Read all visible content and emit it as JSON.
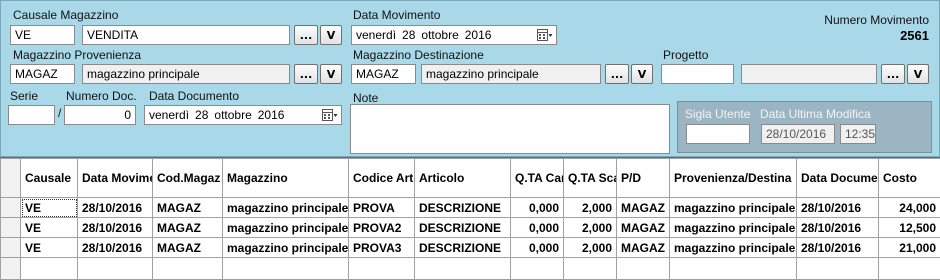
{
  "header": {
    "causale_label": "Causale Magazzino",
    "causale_code": "VE",
    "causale_desc": "VENDITA",
    "data_movimento_label": "Data Movimento",
    "data_movimento": {
      "weekday": "venerdì",
      "day": "28",
      "month": "ottobre",
      "year": "2016"
    },
    "numero_movimento_label": "Numero Movimento",
    "numero_movimento": "2561",
    "mag_prov_label": "Magazzino Provenienza",
    "mag_prov_code": "MAGAZ",
    "mag_prov_desc": "magazzino principale",
    "mag_dest_label": "Magazzino Destinazione",
    "mag_dest_code": "MAGAZ",
    "mag_dest_desc": "magazzino principale",
    "progetto_label": "Progetto",
    "progetto_code": "",
    "progetto_desc": "",
    "serie_label": "Serie",
    "serie_value": "",
    "num_doc_label": "Numero Doc.",
    "num_doc_sep": "/",
    "num_doc_value": "0",
    "data_doc_label": "Data Documento",
    "data_documento": {
      "weekday": "venerdì",
      "day": "28",
      "month": "ottobre",
      "year": "2016"
    },
    "note_label": "Note",
    "note_value": "",
    "sigla_label": "Sigla Utente",
    "sigla_value": "",
    "ultima_mod_label": "Data Ultima Modifica",
    "ultima_mod_date": "28/10/2016",
    "ultima_mod_time": "12:35",
    "dots_button": "...",
    "v_button": "V"
  },
  "grid": {
    "columns": [
      "Causale",
      "Data Movimento",
      "Cod.Magaz",
      "Magazzino",
      "Codice Articolo",
      "Articolo",
      "Q.TA Car.",
      "Q.TA Scar.",
      "P/D",
      "Provenienza/Destina",
      "Data Documento",
      "Costo"
    ],
    "rows": [
      [
        "VE",
        "28/10/2016",
        "MAGAZ",
        "magazzino principale",
        "PROVA",
        "DESCRIZIONE",
        "0,000",
        "2,000",
        "MAGAZ",
        "magazzino principale",
        "28/10/2016",
        "24,000"
      ],
      [
        "VE",
        "28/10/2016",
        "MAGAZ",
        "magazzino principale",
        "PROVA2",
        "DESCRIZIONE",
        "0,000",
        "2,000",
        "MAGAZ",
        "magazzino principale",
        "28/10/2016",
        "12,500"
      ],
      [
        "VE",
        "28/10/2016",
        "MAGAZ",
        "magazzino principale",
        "PROVA3",
        "DESCRIZIONE",
        "0,000",
        "2,000",
        "MAGAZ",
        "magazzino principale",
        "28/10/2016",
        "21,000"
      ]
    ]
  }
}
